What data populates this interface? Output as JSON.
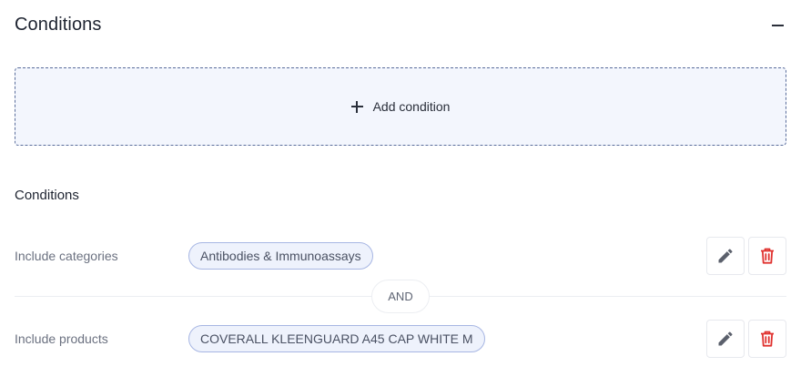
{
  "header": {
    "title": "Conditions",
    "collapse_icon": "minus-icon"
  },
  "add_condition": {
    "label": "Add condition",
    "icon": "plus-icon"
  },
  "conditions_section": {
    "title": "Conditions",
    "operator": "AND",
    "rows": [
      {
        "label": "Include categories",
        "value": "Antibodies & Immunoassays"
      },
      {
        "label": "Include products",
        "value": "COVERALL KLEENGUARD A45 CAP WHITE M"
      }
    ]
  },
  "colors": {
    "edit_icon": "#5b606c",
    "delete_icon": "#e0322f",
    "chip_border": "#a7b6e3",
    "chip_bg": "#eef2fc",
    "dropzone_bg": "#f3f6fd",
    "dropzone_border": "#5a6d9b"
  }
}
